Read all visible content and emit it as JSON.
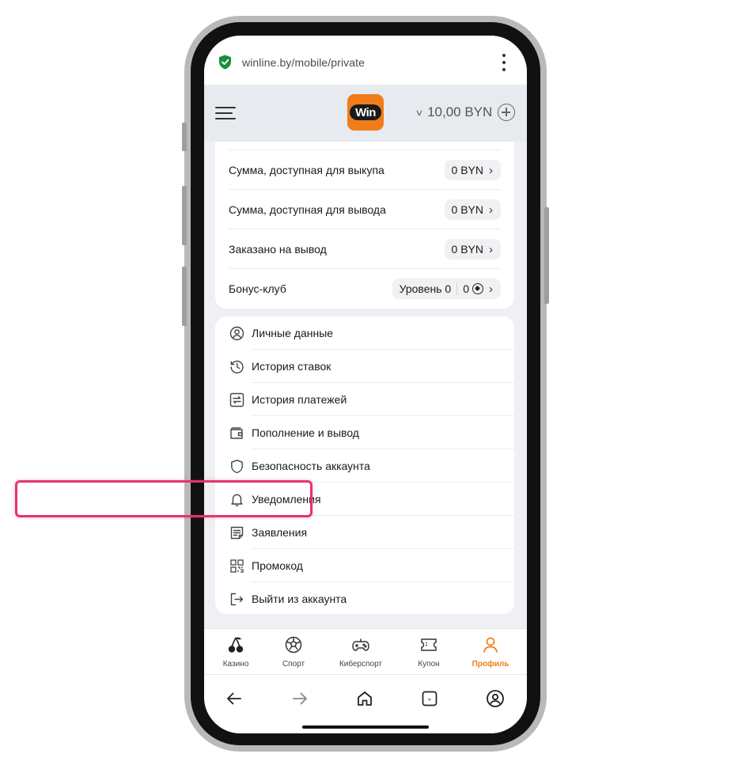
{
  "browser": {
    "url": "winline.by/mobile/private",
    "secure_icon": "shield-check-icon",
    "menu_icon": "kebab-menu-icon",
    "accent_color": "#1a8f3c"
  },
  "header": {
    "logo_text": "Win",
    "balance": "10,00 BYN",
    "brand_color": "#f07d1a"
  },
  "stats": [
    {
      "label": "Сумма, доступная для выкупа",
      "value": "0 BYN"
    },
    {
      "label": "Сумма, доступная для вывода",
      "value": "0 BYN"
    },
    {
      "label": "Заказано на вывод",
      "value": "0 BYN"
    }
  ],
  "bonus": {
    "label": "Бонус-клуб",
    "level": "Уровень 0",
    "points": "0"
  },
  "menu": [
    {
      "label": "Личные данные",
      "icon": "user-circle-icon"
    },
    {
      "label": "История ставок",
      "icon": "history-icon"
    },
    {
      "label": "История платежей",
      "icon": "payments-history-icon"
    },
    {
      "label": "Пополнение и вывод",
      "icon": "wallet-icon"
    },
    {
      "label": "Безопасность аккаунта",
      "icon": "shield-icon"
    },
    {
      "label": "Уведомления",
      "icon": "bell-icon"
    },
    {
      "label": "Заявления",
      "icon": "document-icon",
      "highlighted": true
    },
    {
      "label": "Промокод",
      "icon": "qr-code-icon"
    },
    {
      "label": "Выйти из аккаунта",
      "icon": "logout-icon"
    }
  ],
  "highlight_color": "#e8336b",
  "bottom_nav": [
    {
      "label": "Казино",
      "icon": "cherries-icon"
    },
    {
      "label": "Спорт",
      "icon": "soccer-ball-icon"
    },
    {
      "label": "Киберспорт",
      "icon": "gamepad-icon"
    },
    {
      "label": "Купон",
      "icon": "ticket-icon"
    },
    {
      "label": "Профиль",
      "icon": "profile-icon",
      "active": true
    }
  ],
  "system_nav": [
    "back-arrow-icon",
    "forward-arrow-icon",
    "home-icon",
    "tabs-icon",
    "account-icon"
  ]
}
